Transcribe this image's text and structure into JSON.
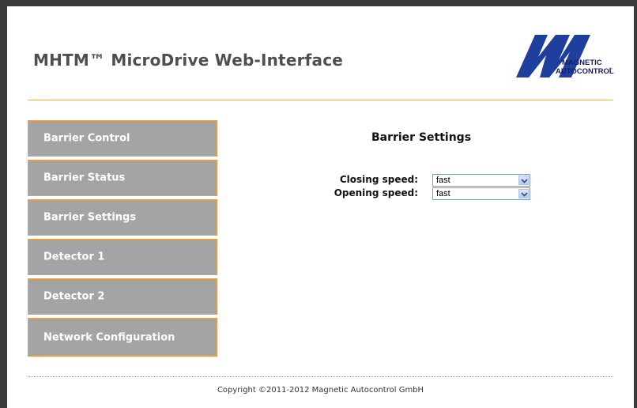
{
  "header": {
    "title": "MHTM™ MicroDrive Web-Interface",
    "logo": {
      "line1": "MAGNETIC",
      "line2": "AUTOCONTROL",
      "icon": "magnetic-autocontrol-logo",
      "brand_color": "#1e3f9e"
    }
  },
  "nav": {
    "items": [
      {
        "label": "Barrier Control"
      },
      {
        "label": "Barrier Status"
      },
      {
        "label": "Barrier Settings"
      },
      {
        "label": "Detector 1"
      },
      {
        "label": "Detector 2"
      },
      {
        "label": "Network Configuration"
      }
    ],
    "bg_color": "#a4a4a4",
    "border_color": "#f0a040"
  },
  "main": {
    "title": "Barrier Settings",
    "fields": [
      {
        "label": "Closing speed:",
        "value": "fast"
      },
      {
        "label": "Opening speed:",
        "value": "fast"
      }
    ]
  },
  "footer": {
    "copyright": "Copyright ©2011-2012 Magnetic Autocontrol GmbH"
  }
}
